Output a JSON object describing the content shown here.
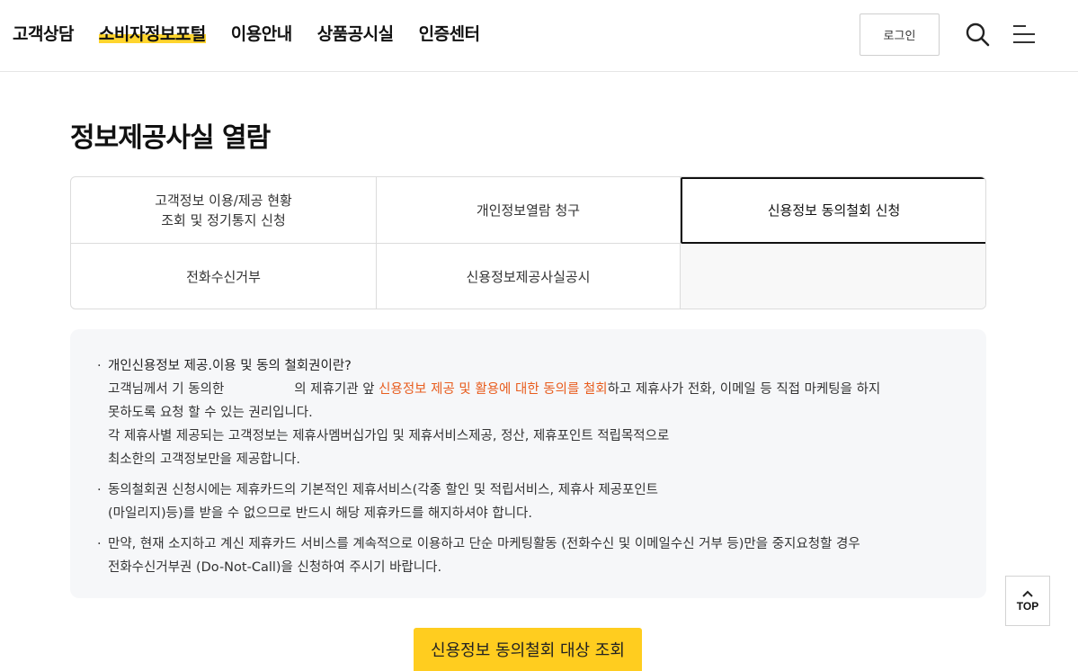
{
  "header": {
    "nav": [
      {
        "label": "고객상담",
        "active": false
      },
      {
        "label": "소비자정보포털",
        "active": true
      },
      {
        "label": "이용안내",
        "active": false
      },
      {
        "label": "상품공시실",
        "active": false
      },
      {
        "label": "인증센터",
        "active": false
      }
    ],
    "login_label": "로그인",
    "icons": [
      "search-icon",
      "menu-icon"
    ]
  },
  "page": {
    "title": "정보제공사실 열람"
  },
  "tabs": [
    {
      "label": "고객정보 이용/제공 현황\n조회 및 정기통지 신청",
      "selected": false
    },
    {
      "label": "개인정보열람 청구",
      "selected": false
    },
    {
      "label": "신용정보 동의철회 신청",
      "selected": true
    },
    {
      "label": "전화수신거부",
      "selected": false
    },
    {
      "label": "신용정보제공사실공시",
      "selected": false
    }
  ],
  "info": {
    "item1": {
      "heading": "개인신용정보 제공.이용 및 동의 철회권이란?",
      "line1_a": "고객님께서 기 동의한",
      "line1_b": "의 제휴기관 앞",
      "line1_highlight": "신용정보 제공 및 활용에 대한 동의를 철회",
      "line1_c": "하고 제휴사가 전화, 이메일 등 직접 마케팅을 하지",
      "line2": "못하도록 요청 할 수 있는 권리입니다.",
      "line3": "각 제휴사별 제공되는 고객정보는 제휴사멤버십가입 및 제휴서비스제공, 정산, 제휴포인트 적립목적으로",
      "line4": "최소한의 고객정보만을 제공합니다."
    },
    "item2": {
      "line1": "동의철회권 신청시에는 제휴카드의 기본적인 제휴서비스(각종 할인 및 적립서비스, 제휴사 제공포인트",
      "line2": "(마일리지)등)를 받을 수 없으므로 반드시 해당 제휴카드를 해지하셔야 합니다."
    },
    "item3": {
      "line1": "만약, 현재 소지하고 계신 제휴카드 서비스를 계속적으로 이용하고 단순 마케팅활동 (전화수신 및 이메일수신 거부 등)만을 중지요청할 경우",
      "line2": "전화수신거부권 (Do-Not-Call)을 신청하여 주시기 바랍니다."
    }
  },
  "top_button": {
    "label": "TOP"
  },
  "submit_button": {
    "label": "신용정보 동의철회 대상 조회"
  },
  "colors": {
    "accent": "#ffcd1f",
    "highlight_text": "#e85d1e",
    "info_bg": "#f6f7f9"
  }
}
